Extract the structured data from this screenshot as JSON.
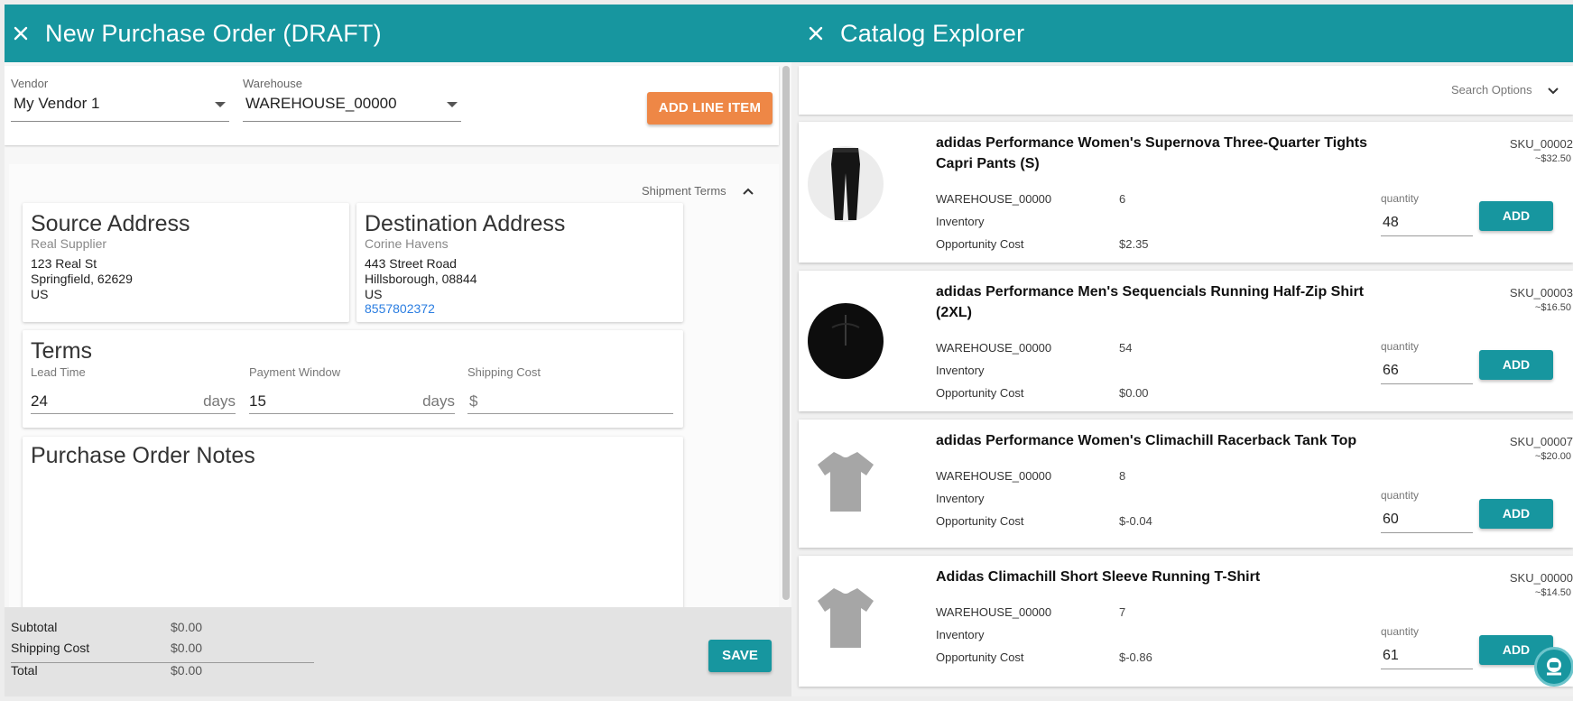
{
  "po_panel": {
    "title": "New Purchase Order (DRAFT)",
    "vendor": {
      "label": "Vendor",
      "value": "My Vendor 1"
    },
    "warehouse": {
      "label": "Warehouse",
      "value": "WAREHOUSE_00000"
    },
    "add_line_item": "ADD LINE ITEM",
    "shipment_terms": "Shipment Terms",
    "source": {
      "heading": "Source Address",
      "name": "Real Supplier",
      "street": "123 Real St",
      "city": "Springfield, 62629",
      "country": "US"
    },
    "destination": {
      "heading": "Destination Address",
      "name": "Corine Havens",
      "street": "443 Street Road",
      "city": "Hillsborough, 08844",
      "country": "US",
      "phone": "8557802372"
    },
    "terms": {
      "heading": "Terms",
      "lead_time": {
        "label": "Lead Time",
        "value": "24",
        "suffix": "days"
      },
      "payment_window": {
        "label": "Payment Window",
        "value": "15",
        "suffix": "days"
      },
      "shipping_cost": {
        "label": "Shipping Cost",
        "prefix": "$"
      }
    },
    "notes_heading": "Purchase Order Notes",
    "footer": {
      "subtotal_label": "Subtotal",
      "subtotal": "$0.00",
      "shipping_label": "Shipping Cost",
      "shipping": "$0.00",
      "total_label": "Total",
      "total": "$0.00",
      "save": "SAVE"
    }
  },
  "catalog_panel": {
    "title": "Catalog Explorer",
    "search_options": "Search Options",
    "labels": {
      "warehouse": "WAREHOUSE_00000",
      "inventory": "Inventory",
      "opportunity": "Opportunity Cost",
      "quantity": "quantity",
      "add": "ADD"
    },
    "products": [
      {
        "name": "adidas Performance Women's Supernova Three-Quarter Tights Capri Pants (S)",
        "sku": "SKU_00002",
        "price": "~$32.50",
        "warehouse_qty": "6",
        "opportunity_cost": "$2.35",
        "quantity": "48",
        "thumb_icon": "black-capri-pants-icon"
      },
      {
        "name": "adidas Performance Men's Sequencials Running Half-Zip Shirt (2XL)",
        "sku": "SKU_00003",
        "price": "~$16.50",
        "warehouse_qty": "54",
        "opportunity_cost": "$0.00",
        "quantity": "66",
        "thumb_icon": "black-half-zip-shirt-icon"
      },
      {
        "name": "adidas Performance Women's Climachill Racerback Tank Top",
        "sku": "SKU_00007",
        "price": "~$20.00",
        "warehouse_qty": "8",
        "opportunity_cost": "$-0.04",
        "quantity": "60",
        "thumb_icon": "grey-tshirt-icon"
      },
      {
        "name": "Adidas Climachill Short Sleeve Running T-Shirt",
        "sku": "SKU_00000",
        "price": "~$14.50",
        "warehouse_qty": "7",
        "opportunity_cost": "$-0.86",
        "quantity": "61",
        "thumb_icon": "grey-tshirt-icon"
      }
    ]
  },
  "colors": {
    "teal": "#17969f",
    "orange": "#ee8746",
    "link": "#2a7de1"
  }
}
